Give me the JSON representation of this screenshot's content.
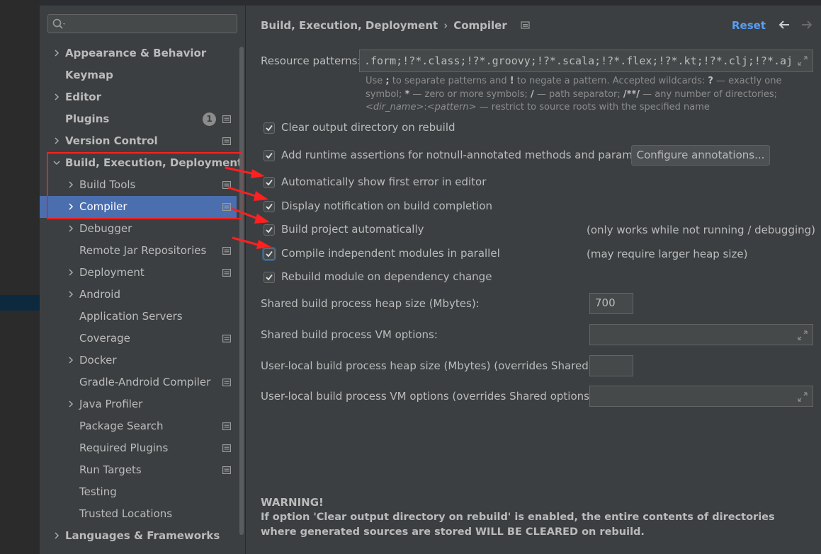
{
  "sidebar": {
    "search": {
      "placeholder": ""
    },
    "items": [
      {
        "label": "Appearance & Behavior",
        "level": 0,
        "bold": true,
        "arrow": "right"
      },
      {
        "label": "Keymap",
        "level": 0,
        "bold": true,
        "arrow": "none"
      },
      {
        "label": "Editor",
        "level": 0,
        "bold": true,
        "arrow": "right"
      },
      {
        "label": "Plugins",
        "level": 0,
        "bold": true,
        "arrow": "none",
        "badge": "1",
        "project": true
      },
      {
        "label": "Version Control",
        "level": 0,
        "bold": true,
        "arrow": "right",
        "project": true
      },
      {
        "label": "Build, Execution, Deployment",
        "level": 0,
        "bold": true,
        "arrow": "down"
      },
      {
        "label": "Build Tools",
        "level": 1,
        "arrow": "right",
        "project": true
      },
      {
        "label": "Compiler",
        "level": 1,
        "arrow": "right",
        "project": true,
        "selected": true
      },
      {
        "label": "Debugger",
        "level": 1,
        "arrow": "right"
      },
      {
        "label": "Remote Jar Repositories",
        "level": 1,
        "arrow": "none",
        "project": true
      },
      {
        "label": "Deployment",
        "level": 1,
        "arrow": "right",
        "project": true
      },
      {
        "label": "Android",
        "level": 1,
        "arrow": "right"
      },
      {
        "label": "Application Servers",
        "level": 1,
        "arrow": "none"
      },
      {
        "label": "Coverage",
        "level": 1,
        "arrow": "none",
        "project": true
      },
      {
        "label": "Docker",
        "level": 1,
        "arrow": "right"
      },
      {
        "label": "Gradle-Android Compiler",
        "level": 1,
        "arrow": "none",
        "project": true
      },
      {
        "label": "Java Profiler",
        "level": 1,
        "arrow": "right"
      },
      {
        "label": "Package Search",
        "level": 1,
        "arrow": "none",
        "project": true
      },
      {
        "label": "Required Plugins",
        "level": 1,
        "arrow": "none",
        "project": true
      },
      {
        "label": "Run Targets",
        "level": 1,
        "arrow": "none",
        "project": true
      },
      {
        "label": "Testing",
        "level": 1,
        "arrow": "none"
      },
      {
        "label": "Trusted Locations",
        "level": 1,
        "arrow": "none"
      },
      {
        "label": "Languages & Frameworks",
        "level": 0,
        "bold": true,
        "arrow": "right"
      }
    ]
  },
  "header": {
    "breadcrumb": [
      "Build, Execution, Deployment",
      "Compiler"
    ],
    "reset": "Reset"
  },
  "resource_patterns": {
    "label": "Resource patterns:",
    "value": ".form;!?*.class;!?*.groovy;!?*.scala;!?*.flex;!?*.kt;!?*.clj;!?*.aj",
    "help": {
      "p1": "Use ",
      "semicolon": ";",
      "p2": " to separate patterns and ",
      "bang": "!",
      "p3": " to negate a pattern. Accepted wildcards: ",
      "q": "?",
      "p4": " — exactly one symbol; ",
      "star": "*",
      "p5": " — zero or more symbols; ",
      "slash": "/",
      "p6": " — path separator; ",
      "dstar": "/**/",
      "p7": " — any number of directories; ",
      "dirname": "<dir_name>",
      "colon": ":",
      "pattern": "<pattern>",
      "p8": " — restrict to source roots with the specified name"
    }
  },
  "options": [
    {
      "label": "Clear output directory on rebuild",
      "checked": true
    },
    {
      "label": "Add runtime assertions for notnull-annotated methods and parameters",
      "checked": true
    },
    {
      "label": "Automatically show first error in editor",
      "checked": true
    },
    {
      "label": "Display notification on build completion",
      "checked": true
    },
    {
      "label": "Build project automatically",
      "checked": true,
      "note": "(only works while not running / debugging)"
    },
    {
      "label": "Compile independent modules in parallel",
      "checked": true,
      "note": "(may require larger heap size)"
    },
    {
      "label": "Rebuild module on dependency change",
      "checked": true
    }
  ],
  "configure_button": "Configure annotations...",
  "fields": [
    {
      "label": "Shared build process heap size (Mbytes):",
      "value": "700"
    },
    {
      "label": "Shared build process VM options:",
      "value": ""
    },
    {
      "label": "User-local build process heap size (Mbytes) (overrides Shared size):",
      "value": ""
    },
    {
      "label": "User-local build process VM options (overrides Shared options):",
      "value": ""
    }
  ],
  "warning": {
    "title": "WARNING!",
    "text": "If option 'Clear output directory on rebuild' is enabled, the entire contents of directories where generated sources are stored WILL BE CLEARED on rebuild."
  },
  "colors": {
    "background": "#3c3f41",
    "selection": "#4b6eaf",
    "link": "#589df6",
    "annotation_red": "#ff2020"
  }
}
